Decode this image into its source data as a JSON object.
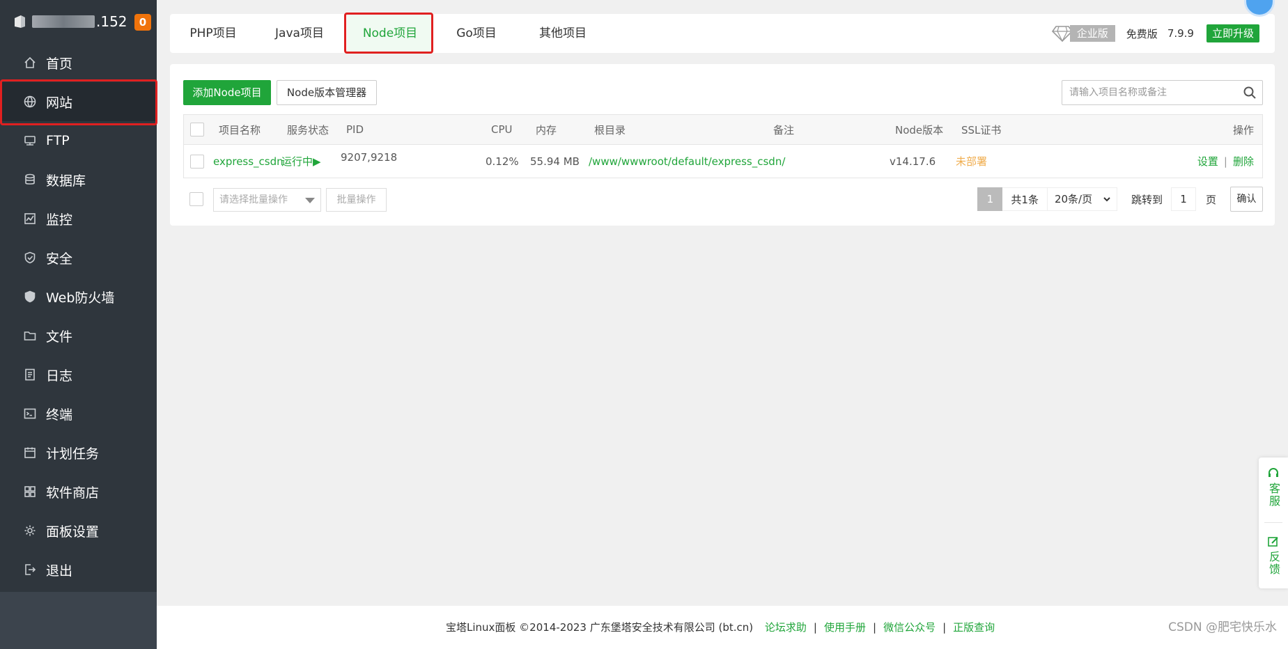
{
  "sidebar": {
    "ip_suffix": ".152",
    "badge": "0",
    "items": [
      {
        "label": "首页",
        "icon": "home-icon"
      },
      {
        "label": "网站",
        "icon": "globe-icon"
      },
      {
        "label": "FTP",
        "icon": "ftp-icon"
      },
      {
        "label": "数据库",
        "icon": "database-icon"
      },
      {
        "label": "监控",
        "icon": "monitor-icon"
      },
      {
        "label": "安全",
        "icon": "shield-icon"
      },
      {
        "label": "Web防火墙",
        "icon": "firewall-icon"
      },
      {
        "label": "文件",
        "icon": "folder-icon"
      },
      {
        "label": "日志",
        "icon": "log-icon"
      },
      {
        "label": "终端",
        "icon": "terminal-icon"
      },
      {
        "label": "计划任务",
        "icon": "calendar-icon"
      },
      {
        "label": "软件商店",
        "icon": "grid-icon"
      },
      {
        "label": "面板设置",
        "icon": "gear-icon"
      },
      {
        "label": "退出",
        "icon": "logout-icon"
      }
    ],
    "active_index": 1
  },
  "tabs": [
    "PHP项目",
    "Java项目",
    "Node项目",
    "Go项目",
    "其他项目"
  ],
  "active_tab": 2,
  "header_right": {
    "enterprise": "企业版",
    "free": "免费版",
    "version": "7.9.9",
    "upgrade": "立即升级"
  },
  "toolbar": {
    "add_label": "添加Node项目",
    "version_mgr_label": "Node版本管理器",
    "search_placeholder": "请输入项目名称或备注"
  },
  "table": {
    "headers": {
      "name": "项目名称",
      "status": "服务状态",
      "pid": "PID",
      "cpu": "CPU",
      "mem": "内存",
      "root": "根目录",
      "remark": "备注",
      "node_version": "Node版本",
      "ssl": "SSL证书",
      "ops": "操作"
    },
    "rows": [
      {
        "name": "express_csdn",
        "status": "运行中▶",
        "pid": "9207,9218",
        "cpu": "0.12%",
        "mem": "55.94 MB",
        "root": "/www/wwwroot/default/express_csdn/",
        "remark": "",
        "node_version": "v14.17.6",
        "ssl": "未部署",
        "op_settings": "设置",
        "op_sep": "|",
        "op_delete": "删除"
      }
    ]
  },
  "batch": {
    "select_placeholder": "请选择批量操作",
    "button": "批量操作"
  },
  "pager": {
    "current": "1",
    "total": "共1条",
    "page_size": "20条/页",
    "jump_label": "跳转到",
    "page_input": "1",
    "page_unit": "页",
    "confirm": "确认"
  },
  "footer": {
    "copyright": "宝塔Linux面板 ©2014-2023 广东堡塔安全技术有限公司 (bt.cn)",
    "links": [
      "论坛求助",
      "使用手册",
      "微信公众号",
      "正版查询"
    ],
    "sep": "|",
    "watermark": "CSDN @肥宅快乐水"
  },
  "float": {
    "service": "客服",
    "feedback": "反馈"
  },
  "colors": {
    "brand_green": "#20a53a",
    "sidebar_bg": "#2f363d",
    "highlight_red": "#e02020",
    "badge_orange": "#f0730b"
  }
}
